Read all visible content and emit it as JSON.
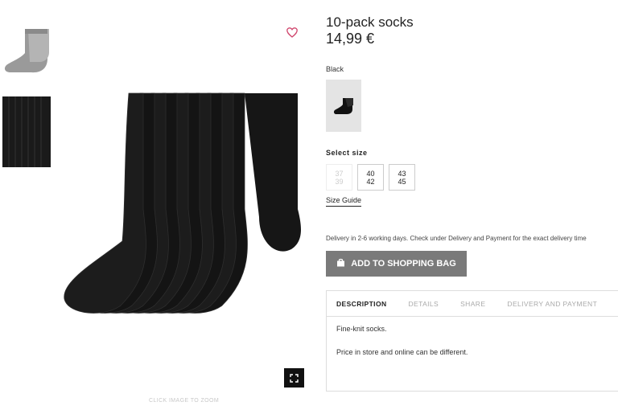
{
  "product": {
    "title": "10-pack socks",
    "price": "14,99 €",
    "color_label": "Black",
    "select_size_label": "Select size",
    "sizes": [
      {
        "line1": "37",
        "line2": "39",
        "available": false
      },
      {
        "line1": "40",
        "line2": "42",
        "available": true
      },
      {
        "line1": "43",
        "line2": "45",
        "available": true
      }
    ],
    "size_guide": "Size Guide",
    "delivery_text": "Delivery in 2-6 working days. Check under Delivery and Payment for the exact delivery time",
    "add_to_bag": "ADD TO SHOPPING BAG"
  },
  "gallery": {
    "zoom_hint": "CLICK IMAGE TO ZOOM",
    "icons": {
      "favorite": "heart-icon",
      "zoom": "fullscreen-icon",
      "bag": "shopping-bag-icon"
    },
    "heart_color": "#d0466d"
  },
  "tabs": [
    {
      "label": "DESCRIPTION",
      "active": true
    },
    {
      "label": "DETAILS",
      "active": false
    },
    {
      "label": "SHARE",
      "active": false
    },
    {
      "label": "DELIVERY AND PAYMENT",
      "active": false
    }
  ],
  "description": {
    "line1": "Fine-knit socks.",
    "line2": "Price in store and online can be different."
  }
}
